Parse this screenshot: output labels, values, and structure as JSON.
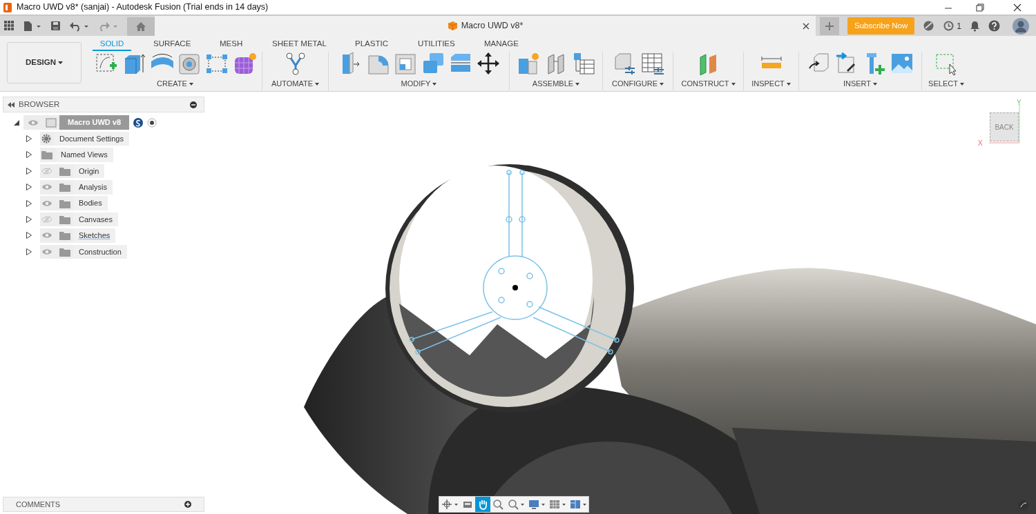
{
  "window": {
    "title": "Macro UWD v8* (sanjai) - Autodesk Fusion (Trial ends in 14 days)"
  },
  "document_tab": {
    "title": "Macro UWD v8*"
  },
  "header": {
    "subscribe_button": "Subscribe Now",
    "job_count": "1"
  },
  "workspace": {
    "label": "DESIGN"
  },
  "tabs": [
    {
      "label": "SOLID",
      "selected": true
    },
    {
      "label": "SURFACE",
      "selected": false
    },
    {
      "label": "MESH",
      "selected": false
    },
    {
      "label": "SHEET METAL",
      "selected": false
    },
    {
      "label": "PLASTIC",
      "selected": false
    },
    {
      "label": "UTILITIES",
      "selected": false
    },
    {
      "label": "MANAGE",
      "selected": false
    }
  ],
  "tool_groups": [
    {
      "label": "CREATE"
    },
    {
      "label": "AUTOMATE"
    },
    {
      "label": "MODIFY"
    },
    {
      "label": "ASSEMBLE"
    },
    {
      "label": "CONFIGURE"
    },
    {
      "label": "CONSTRUCT"
    },
    {
      "label": "INSPECT"
    },
    {
      "label": "INSERT"
    },
    {
      "label": "SELECT"
    }
  ],
  "browser": {
    "title": "BROWSER",
    "root": {
      "label": "Macro UWD v8",
      "expanded": true
    },
    "items": [
      {
        "label": "Document Settings",
        "kind": "settings",
        "has_eye": false
      },
      {
        "label": "Named Views",
        "kind": "folder",
        "has_eye": false
      },
      {
        "label": "Origin",
        "kind": "folder",
        "has_eye": true,
        "visible": false
      },
      {
        "label": "Analysis",
        "kind": "folder",
        "has_eye": true,
        "visible": true
      },
      {
        "label": "Bodies",
        "kind": "folder",
        "has_eye": true,
        "visible": true
      },
      {
        "label": "Canvases",
        "kind": "folder",
        "has_eye": true,
        "visible": false
      },
      {
        "label": "Sketches",
        "kind": "sketch-folder",
        "has_eye": true,
        "visible": true
      },
      {
        "label": "Construction",
        "kind": "folder",
        "has_eye": true,
        "visible": true
      }
    ]
  },
  "view_cube": {
    "face": "BACK",
    "x_axis": "X",
    "y_axis": "Y"
  },
  "comments": {
    "title": "COMMENTS"
  },
  "nav_tools": [
    {
      "kind": "orbit",
      "selected": false
    },
    {
      "kind": "look",
      "selected": false
    },
    {
      "kind": "pan",
      "selected": true
    },
    {
      "kind": "zoom",
      "selected": false
    },
    {
      "kind": "fit",
      "selected": false
    },
    {
      "kind": "display",
      "selected": false
    },
    {
      "kind": "grid",
      "selected": false
    },
    {
      "kind": "viewports",
      "selected": false
    }
  ]
}
